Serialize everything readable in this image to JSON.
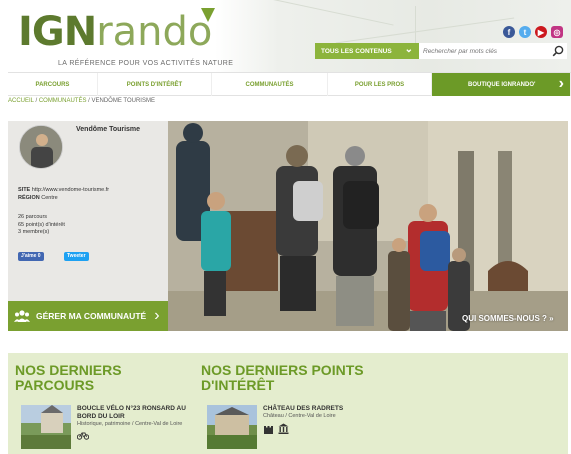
{
  "header": {
    "logo_ign": "IGN",
    "logo_rando": "rando",
    "tagline": "LA RÉFÉRENCE POUR VOS ACTIVITÉS NATURE",
    "social": [
      "facebook-icon",
      "twitter-icon",
      "youtube-icon",
      "instagram-icon"
    ],
    "search_filter": "TOUS LES CONTENUS",
    "search_placeholder": "Rechercher par mots clés"
  },
  "nav": {
    "items": [
      "PARCOURS",
      "POINTS D'INTÉRÊT",
      "COMMUNAUTÉS",
      "POUR LES PROS"
    ],
    "shop": "BOUTIQUE IGNRANDO'"
  },
  "breadcrumb": {
    "home": "ACCUEIL",
    "sep": "/",
    "communities": "COMMUNAUTÉS",
    "current": "VENDÔME TOURISME"
  },
  "profile": {
    "name": "Vendôme Tourisme",
    "site_label": "SITE",
    "site_value": "http://www.vendome-tourisme.fr",
    "region_label": "RÉGION",
    "region_value": "Centre",
    "stats": [
      "26 parcours",
      "65 point(s) d'intérêt",
      "3 membre(s)"
    ],
    "like": "J'aime 0",
    "tweet": "Tweeter",
    "manage": "GÉRER MA COMMUNAUTÉ",
    "about": "QUI SOMMES-NOUS ? »"
  },
  "lower": {
    "routes_title": "NOS DERNIERS PARCOURS",
    "pois_title": "NOS DERNIERS POINTS D'INTÉRÊT",
    "route_item": {
      "title": "BOUCLE VÉLO N°23 RONSARD AU BORD DU LOIR",
      "desc": "Historique, patrimoine / Centre-Val de Loire"
    },
    "poi_item": {
      "title": "CHÂTEAU DES RADRETS",
      "desc": "Château / Centre-Val de Loire"
    }
  },
  "colors": {
    "accent": "#7aa030",
    "accent_dark": "#6c9a27",
    "light_panel": "#e4edce"
  }
}
